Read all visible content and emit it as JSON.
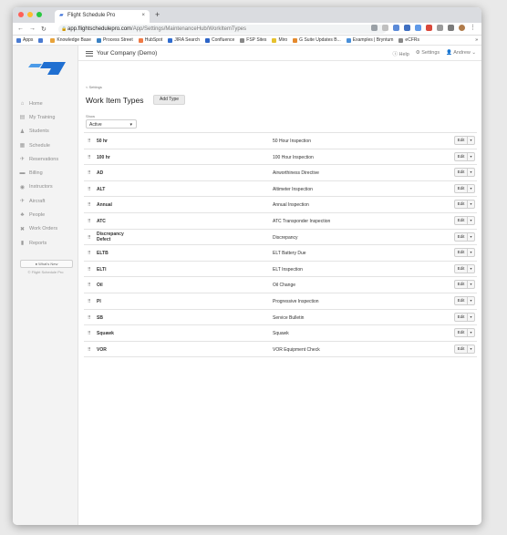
{
  "browser": {
    "tab_title": "Flight Schedule Pro",
    "tab_close": "×",
    "new_tab": "+",
    "url_host": "app.flightschedulepro.com",
    "url_path": "/App/Settings/MaintenanceHub/WorkItemTypes",
    "bookmarks": [
      {
        "label": "Apps",
        "color": "#4a7bd1"
      },
      {
        "label": "",
        "color": "#4a7bd1"
      },
      {
        "label": "Knowledge Base",
        "color": "#e8a33a"
      },
      {
        "label": "Process Street",
        "color": "#3b82c4"
      },
      {
        "label": "HubSpot",
        "color": "#ef7a45"
      },
      {
        "label": "JIRA Search",
        "color": "#2f6ccf"
      },
      {
        "label": "Confluence",
        "color": "#2c64c7"
      },
      {
        "label": "FSP Sites",
        "color": "#888888"
      },
      {
        "label": "Miro",
        "color": "#e6c12e"
      },
      {
        "label": "G Suite Updates B...",
        "color": "#e58a2d"
      },
      {
        "label": "Examples | Bryntum",
        "color": "#4a90d9"
      },
      {
        "label": "eCFRs",
        "color": "#888888"
      }
    ],
    "more_bookmarks": "»"
  },
  "header": {
    "company": "Your Company (Demo)",
    "help": "Help",
    "settings": "Settings",
    "user": "Andrew"
  },
  "sidebar": {
    "items": [
      {
        "label": "Home",
        "icon": "home-icon",
        "glyph": "⌂"
      },
      {
        "label": "My Training",
        "icon": "training-icon",
        "glyph": "▤"
      },
      {
        "label": "Students",
        "icon": "students-icon",
        "glyph": "♟"
      },
      {
        "label": "Schedule",
        "icon": "schedule-icon",
        "glyph": "▦"
      },
      {
        "label": "Reservations",
        "icon": "reservations-icon",
        "glyph": "✈"
      },
      {
        "label": "Billing",
        "icon": "billing-icon",
        "glyph": "▬"
      },
      {
        "label": "Instructors",
        "icon": "instructors-icon",
        "glyph": "◉"
      },
      {
        "label": "Aircraft",
        "icon": "aircraft-icon",
        "glyph": "✈"
      },
      {
        "label": "People",
        "icon": "people-icon",
        "glyph": "♣"
      },
      {
        "label": "Work Orders",
        "icon": "work-orders-icon",
        "glyph": "✖"
      },
      {
        "label": "Reports",
        "icon": "reports-icon",
        "glyph": "▮"
      }
    ],
    "whats_new": "What's New",
    "copyright": "© Flight Schedule Pro"
  },
  "page": {
    "breadcrumb": "< Settings",
    "title": "Work Item Types",
    "add_button": "Add Type",
    "show_label": "Show",
    "show_value": "Active"
  },
  "rows": [
    {
      "code": "50 hr",
      "desc": "50 Hour Inspection"
    },
    {
      "code": "100 hr",
      "desc": "100 Hour Inspection"
    },
    {
      "code": "AD",
      "desc": "Airworthiness Directive"
    },
    {
      "code": "ALT",
      "desc": "Altimeter Inspection"
    },
    {
      "code": "Annual",
      "desc": "Annual Inspection"
    },
    {
      "code": "ATC",
      "desc": "ATC Transponder Inspection"
    },
    {
      "code": "Discrepancy Defect",
      "desc": "Discrepancy"
    },
    {
      "code": "ELTB",
      "desc": "ELT Battery Due"
    },
    {
      "code": "ELTI",
      "desc": "ELT Inspection"
    },
    {
      "code": "Oil",
      "desc": "Oil Change"
    },
    {
      "code": "PI",
      "desc": "Progressive Inspection"
    },
    {
      "code": "SB",
      "desc": "Service Bulletin"
    },
    {
      "code": "Squawk",
      "desc": "Squawk"
    },
    {
      "code": "VOR",
      "desc": "VOR Equipment Check"
    }
  ],
  "edit_label": "Edit",
  "colors": {
    "brand": "#1f6fd1",
    "accent_light": "#4c9be8"
  }
}
